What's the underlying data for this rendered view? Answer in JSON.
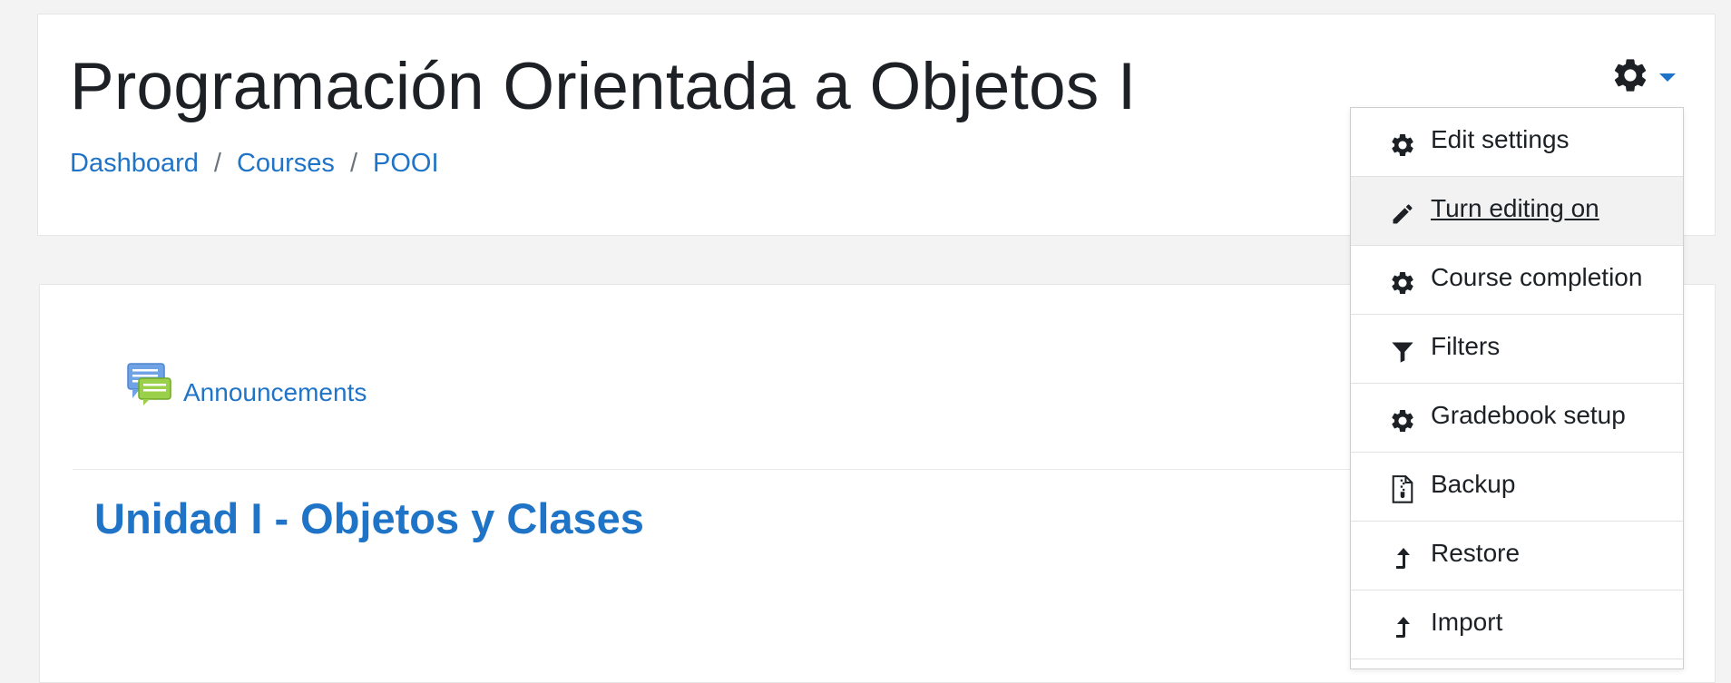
{
  "header": {
    "title": "Programación Orientada a Objetos I",
    "breadcrumb": [
      {
        "label": "Dashboard"
      },
      {
        "label": "Courses"
      },
      {
        "label": "POOI"
      }
    ],
    "breadcrumb_separator": "/",
    "actions_icon": "gear-icon"
  },
  "main": {
    "announcements": {
      "label": "Announcements",
      "icon": "forum-icon"
    },
    "section_title": "Unidad I - Objetos y Clases"
  },
  "action_menu": {
    "items": [
      {
        "label": "Edit settings",
        "icon": "gear-icon"
      },
      {
        "label": "Turn editing on",
        "icon": "pencil-icon",
        "active": true
      },
      {
        "label": "Course completion",
        "icon": "gear-icon"
      },
      {
        "label": "Filters",
        "icon": "filter-icon"
      },
      {
        "label": "Gradebook setup",
        "icon": "gear-icon"
      },
      {
        "label": "Backup",
        "icon": "file-archive-icon"
      },
      {
        "label": "Restore",
        "icon": "level-up-icon"
      },
      {
        "label": "Import",
        "icon": "level-up-icon"
      }
    ]
  },
  "colors": {
    "link": "#1f74c7",
    "text": "#1d2125",
    "page_bg": "#f3f3f3",
    "card_bg": "#ffffff",
    "active_item_bg": "#f2f2f2"
  }
}
